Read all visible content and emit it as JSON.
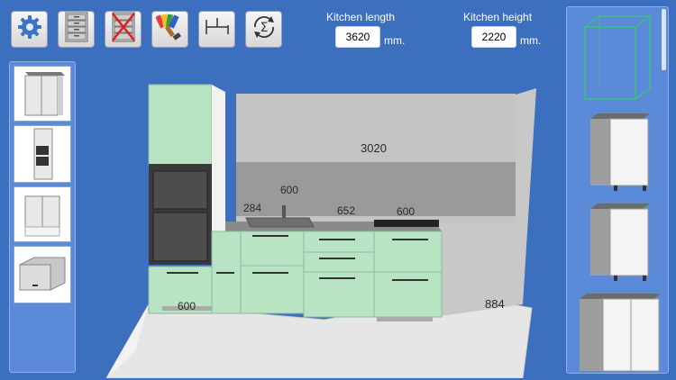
{
  "toolbar": {
    "buttons": [
      {
        "name": "settings-button",
        "icon": "gear-icon"
      },
      {
        "name": "cabinets-button",
        "icon": "drawer-cabinet-icon"
      },
      {
        "name": "delete-cabinet-button",
        "icon": "delete-cabinet-icon"
      },
      {
        "name": "colors-button",
        "icon": "palette-brush-icon"
      },
      {
        "name": "dimensions-button",
        "icon": "dimension-icon"
      },
      {
        "name": "calculate-button",
        "icon": "sigma-refresh-icon"
      }
    ]
  },
  "kitchen": {
    "length_label": "Kitchen length",
    "length_value": "3620",
    "height_label": "Kitchen height",
    "height_value": "2220",
    "unit": "mm."
  },
  "measurements": {
    "wall_width": "3020",
    "m284": "284",
    "m600_top": "600",
    "m652": "652",
    "m600_right": "600",
    "m884": "884",
    "m600_bottom": "600"
  },
  "colors": {
    "background": "#3d6fbf",
    "cabinet_green": "#b9e4c4"
  }
}
